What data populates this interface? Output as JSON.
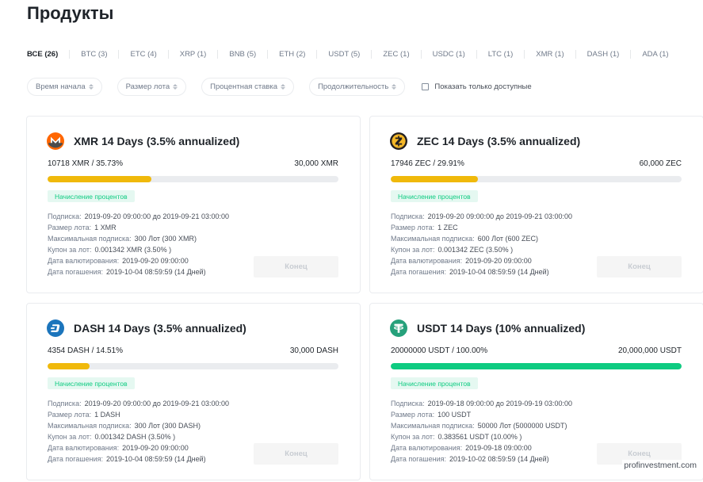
{
  "page": {
    "title": "Продукты"
  },
  "tabs": [
    {
      "label": "ВСЕ (26)",
      "active": true
    },
    {
      "label": "BTC (3)"
    },
    {
      "label": "ETC (4)"
    },
    {
      "label": "XRP (1)"
    },
    {
      "label": "BNB (5)"
    },
    {
      "label": "ETH (2)"
    },
    {
      "label": "USDT (5)"
    },
    {
      "label": "ZEC (1)"
    },
    {
      "label": "USDC (1)"
    },
    {
      "label": "LTC (1)"
    },
    {
      "label": "XMR (1)"
    },
    {
      "label": "DASH (1)"
    },
    {
      "label": "ADA (1)"
    }
  ],
  "filters": {
    "start_time": "Время начала",
    "lot_size": "Размер лота",
    "interest_rate": "Процентная ставка",
    "duration": "Продолжительность",
    "only_available": "Показать только доступные"
  },
  "labels": {
    "subscription": "Подписка:",
    "lot_size": "Размер лота:",
    "max_subscription": "Максимальная подписка:",
    "coupon": "Купон за лот:",
    "value_date": "Дата валютирования:",
    "redemption_date": "Дата погашения:"
  },
  "status_badge": "Начисление процентов",
  "end_button": "Конец",
  "colors": {
    "progress_yellow": "#f0b90b",
    "progress_green": "#0ecb81",
    "badge_bg": "#e5f8f1"
  },
  "products": [
    {
      "coin": "XMR",
      "icon": "monero-icon",
      "icon_color": "#ff6600",
      "title": "XMR 14 Days (3.5% annualized)",
      "progress_text": "10718 XMR / 35.73%",
      "total": "30,000 XMR",
      "progress_percent": 35.73,
      "bar_color": "#f0b90b",
      "subscription": "2019-09-20 09:00:00 до 2019-09-21 03:00:00",
      "lot_size": "1 XMR",
      "max_subscription": "300 Лот (300 XMR)",
      "coupon": "0.001342 XMR (3.50% )",
      "value_date": "2019-09-20 09:00:00",
      "redemption_date": "2019-10-04 08:59:59 (14 Дней)"
    },
    {
      "coin": "ZEC",
      "icon": "zcash-icon",
      "icon_color": "#f4b728",
      "title": "ZEC 14 Days (3.5% annualized)",
      "progress_text": "17946 ZEC / 29.91%",
      "total": "60,000 ZEC",
      "progress_percent": 29.91,
      "bar_color": "#f0b90b",
      "subscription": "2019-09-20 09:00:00 до 2019-09-21 03:00:00",
      "lot_size": "1 ZEC",
      "max_subscription": "600 Лот (600 ZEC)",
      "coupon": "0.001342 ZEC (3.50% )",
      "value_date": "2019-09-20 09:00:00",
      "redemption_date": "2019-10-04 08:59:59 (14 Дней)"
    },
    {
      "coin": "DASH",
      "icon": "dash-icon",
      "icon_color": "#1c75bc",
      "title": "DASH 14 Days (3.5% annualized)",
      "progress_text": "4354 DASH / 14.51%",
      "total": "30,000 DASH",
      "progress_percent": 14.51,
      "bar_color": "#f0b90b",
      "subscription": "2019-09-20 09:00:00 до 2019-09-21 03:00:00",
      "lot_size": "1 DASH",
      "max_subscription": "300 Лот (300 DASH)",
      "coupon": "0.001342 DASH (3.50% )",
      "value_date": "2019-09-20 09:00:00",
      "redemption_date": "2019-10-04 08:59:59 (14 Дней)"
    },
    {
      "coin": "USDT",
      "icon": "tether-icon",
      "icon_color": "#26a17b",
      "title": "USDT 14 Days (10% annualized)",
      "progress_text": "20000000 USDT / 100.00%",
      "total": "20,000,000 USDT",
      "progress_percent": 100,
      "bar_color": "#0ecb81",
      "subscription": "2019-09-18 09:00:00 до 2019-09-19 03:00:00",
      "lot_size": "100 USDT",
      "max_subscription": "50000 Лот (5000000 USDT)",
      "coupon": "0.383561 USDT (10.00% )",
      "value_date": "2019-09-18 09:00:00",
      "redemption_date": "2019-10-02 08:59:59 (14 Дней)"
    }
  ],
  "watermark": "profinvestment.com"
}
